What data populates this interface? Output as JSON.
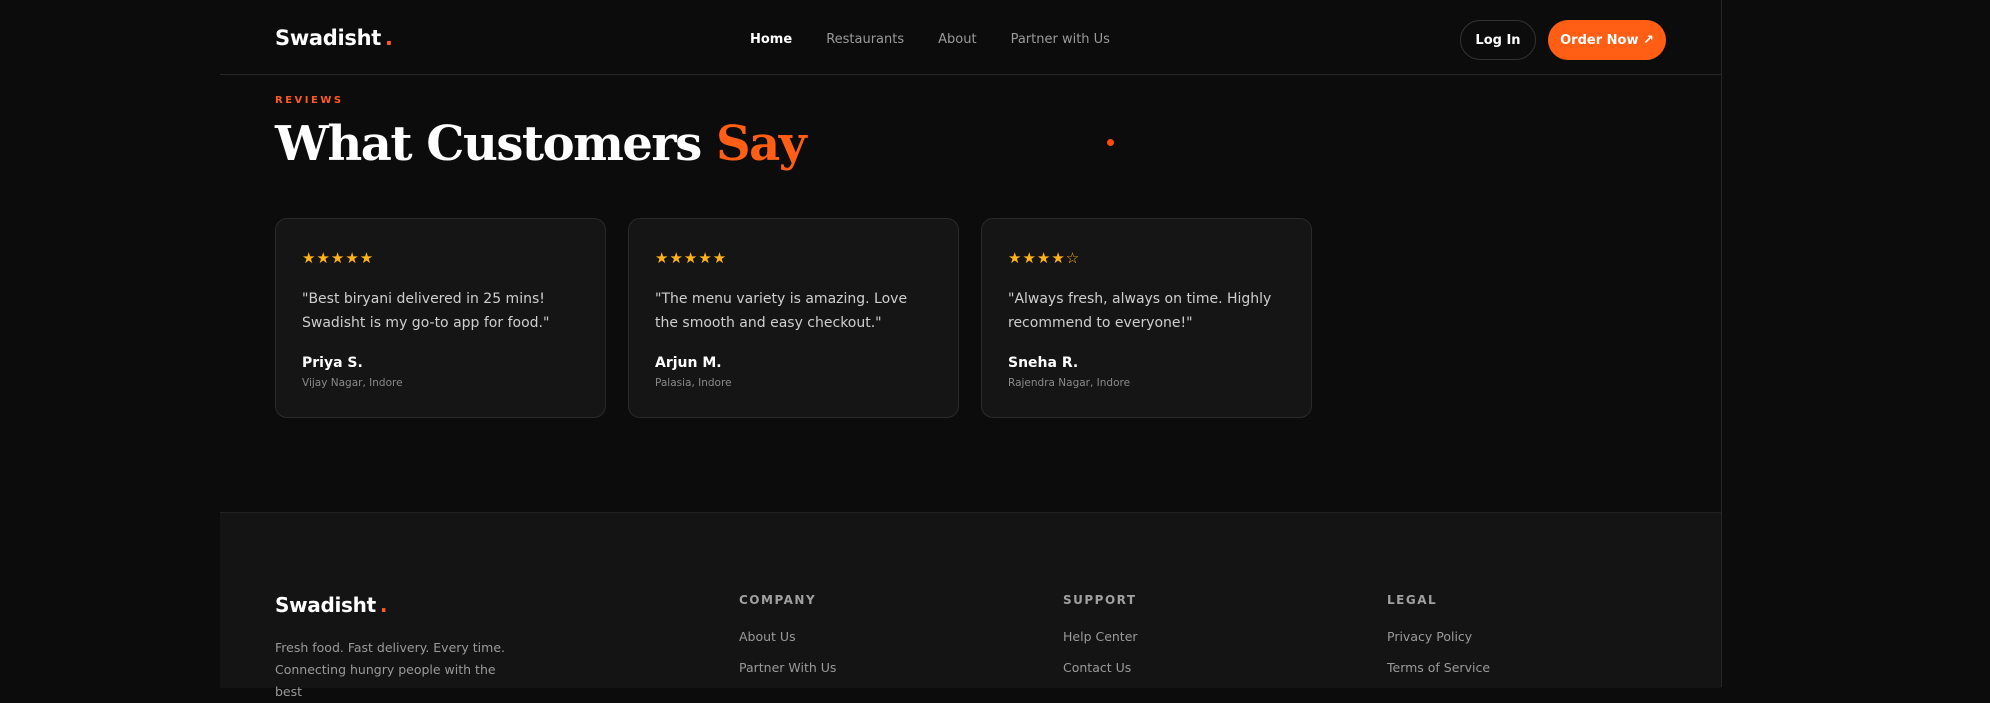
{
  "header": {
    "brand": "Swadisht",
    "brand_dot": ".",
    "nav": [
      "Home",
      "Restaurants",
      "About",
      "Partner with Us"
    ],
    "active_nav": "Home",
    "login": "Log In",
    "order": "Order Now ↗"
  },
  "reviews": {
    "eyebrow": "REVIEWS",
    "title_main": "What Customers",
    "title_accent": "Say",
    "items": [
      {
        "stars": "★★★★★",
        "rating": 5,
        "quote": "\"Best biryani delivered in 25 mins! Swadisht is my go-to app for food.\"",
        "name": "Priya S.",
        "location": "Vijay Nagar, Indore"
      },
      {
        "stars": "★★★★★",
        "rating": 5,
        "quote": "\"The menu variety is amazing. Love the smooth and easy checkout.\"",
        "name": "Arjun M.",
        "location": "Palasia, Indore"
      },
      {
        "stars": "★★★★☆",
        "rating": 4,
        "quote": "\"Always fresh, always on time. Highly recommend to everyone!\"",
        "name": "Sneha R.",
        "location": "Rajendra Nagar, Indore"
      }
    ]
  },
  "footer": {
    "brand": "Swadisht",
    "brand_dot": ".",
    "tagline": "Fresh food. Fast delivery. Every time. Connecting hungry people with the best",
    "columns": [
      {
        "title": "COMPANY",
        "links": [
          "About Us",
          "Partner With Us"
        ]
      },
      {
        "title": "SUPPORT",
        "links": [
          "Help Center",
          "Contact Us"
        ]
      },
      {
        "title": "LEGAL",
        "links": [
          "Privacy Policy",
          "Terms of Service"
        ]
      }
    ]
  },
  "colors": {
    "accent": "#ff5e14",
    "star": "#ffb31a",
    "background": "#0c0c0c",
    "card": "#151515"
  }
}
